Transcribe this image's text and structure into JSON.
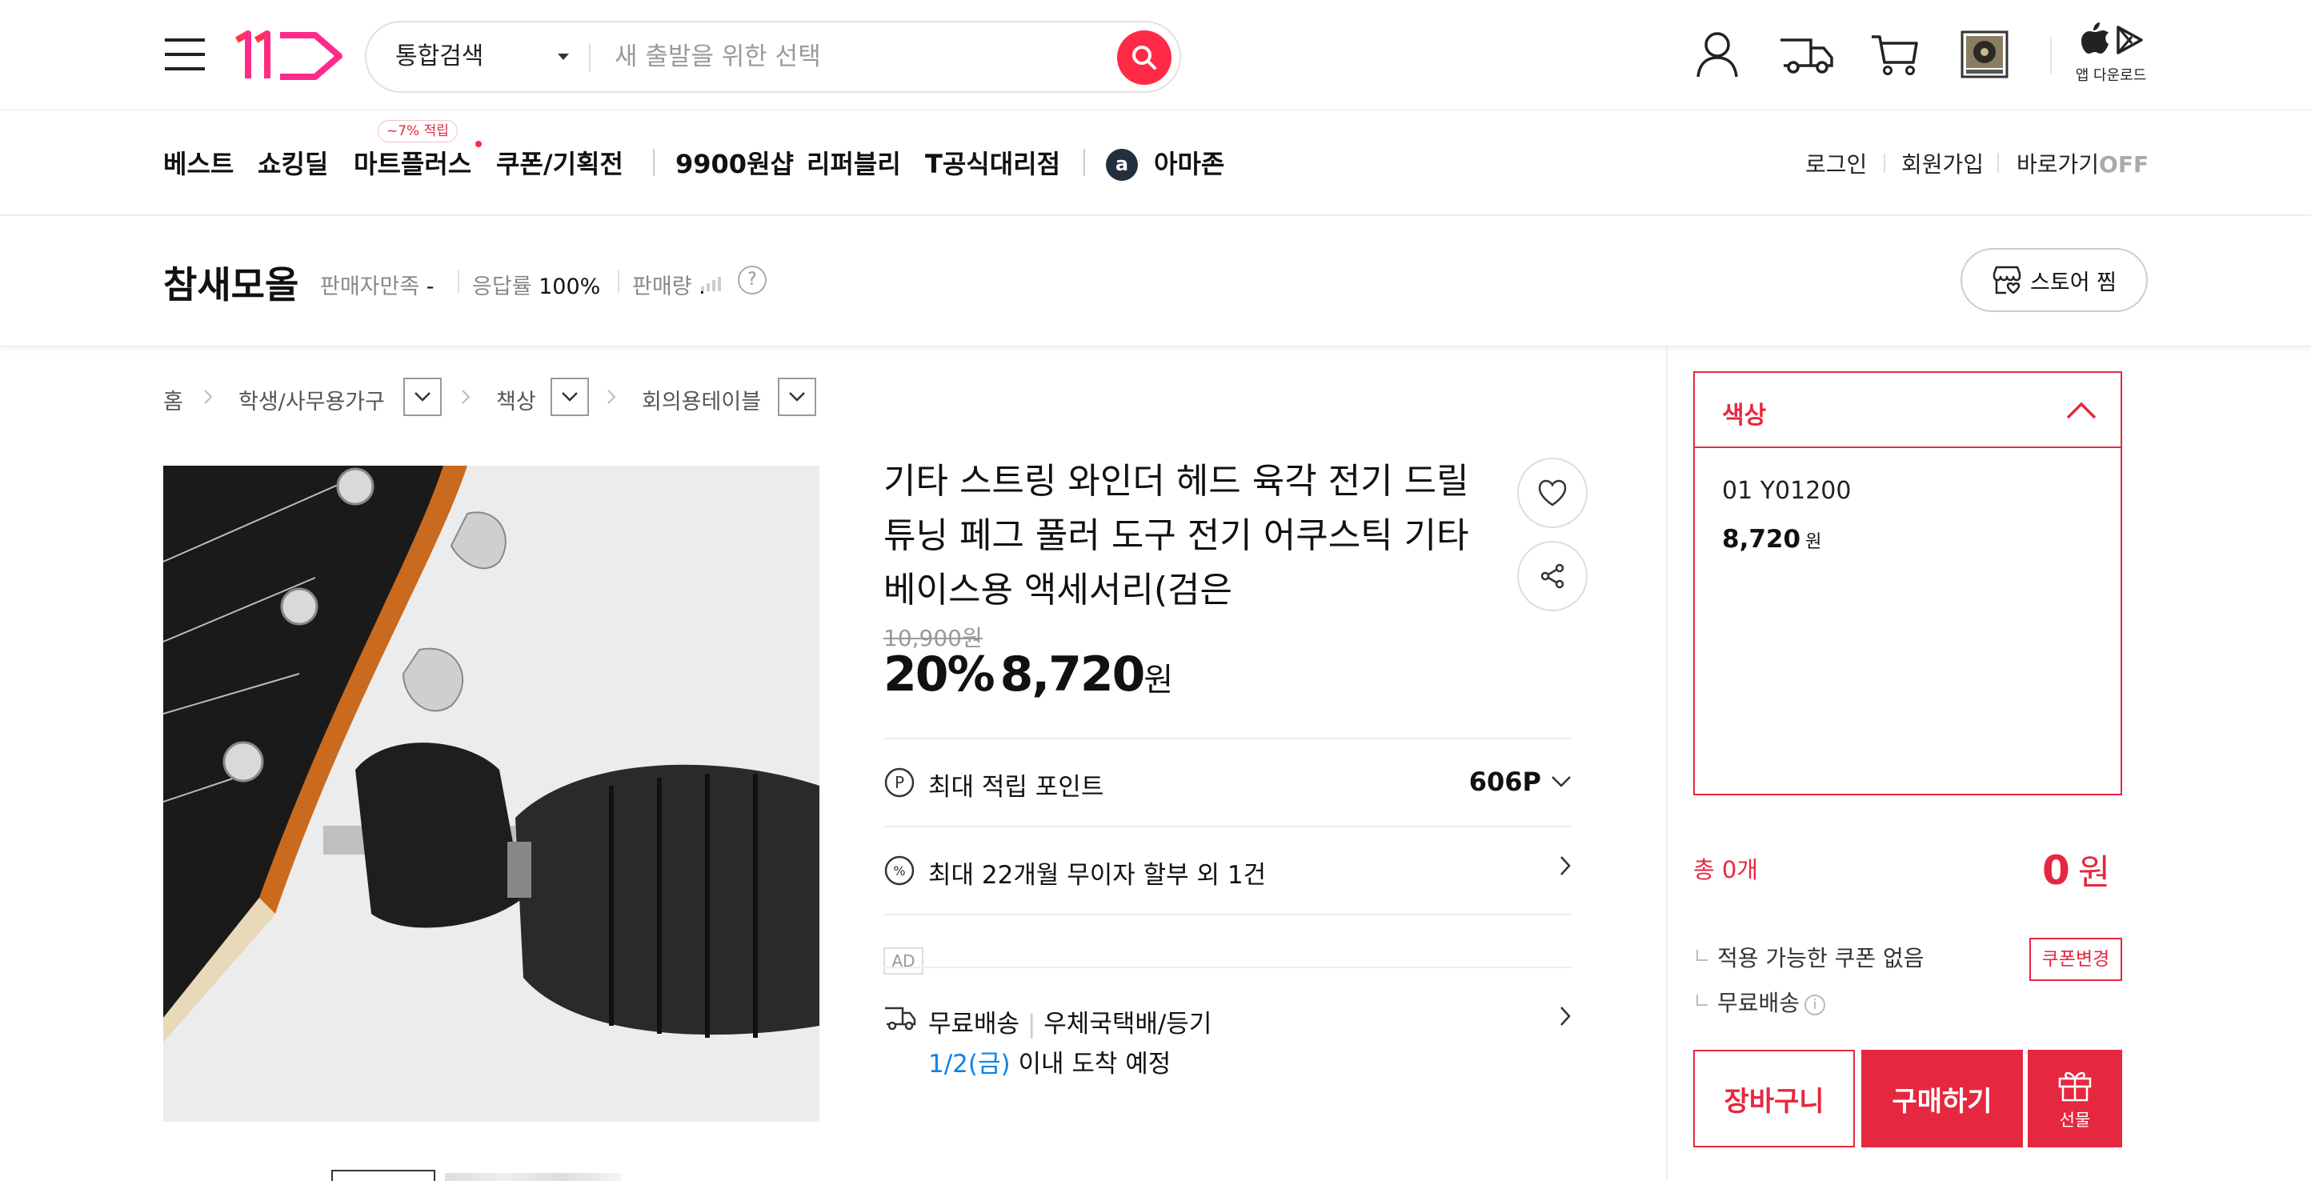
{
  "header": {
    "logo_text": "11",
    "search": {
      "category": "통합검색",
      "placeholder": "새 출발을 위한 선택"
    },
    "app_download_label": "앱 다운로드"
  },
  "nav": {
    "items": [
      "베스트",
      "쇼킹딜",
      "마트플러스",
      "쿠폰/기획전",
      "9900원샵",
      "리퍼블리",
      "T공식대리점",
      "아마존"
    ],
    "mart_badge": "~7% 적립",
    "amazon_logo_letter": "a",
    "right": {
      "login": "로그인",
      "signup": "회원가입",
      "shortcut": "바로가기",
      "shortcut_state": "OFF"
    }
  },
  "store": {
    "name": "참새모올",
    "satisfaction_label": "판매자만족",
    "satisfaction_value": "-",
    "response_label": "응답률",
    "response_value": "100%",
    "sales_label": "판매량",
    "sales_value": ".",
    "help": "?",
    "favorite_label": "스토어 찜"
  },
  "breadcrumb": [
    "홈",
    "학생/사무용가구",
    "책상",
    "회의용테이블"
  ],
  "product": {
    "title": "기타 스트링 와인더 헤드 육각 전기 드릴 튜닝 페그 풀러 도구 전기 어쿠스틱 기타 베이스용 액세서리(검은",
    "original_price": "10,900원",
    "discount": "20%",
    "price": "8,720",
    "price_unit": "원",
    "points_label": "최대 적립 포인트",
    "points_value": "606P",
    "installment_label": "최대 22개월 무이자 할부 외 1건",
    "ad_label": "AD",
    "shipping_free": "무료배송",
    "shipping_method": "우체국택배/등기",
    "arrival_date": "1/2(금)",
    "arrival_text": "이내 도착 예정"
  },
  "order_panel": {
    "option_label": "색상",
    "option_item": "01 Y01200",
    "option_price": "8,720",
    "option_price_unit": "원",
    "total_label": "총 0개",
    "total_amount": "0",
    "total_unit": "원",
    "coupon_text": "적용 가능한 쿠폰 없음",
    "coupon_button": "쿠폰변경",
    "free_shipping": "무료배송",
    "info_icon": "i",
    "cart_button": "장바구니",
    "buy_button": "구매하기",
    "gift_button": "선물"
  },
  "colors": {
    "accent": "#e5283f",
    "search_button": "#ff2a45",
    "link_blue": "#0b83e6"
  },
  "icons": [
    "hamburger-icon",
    "search-icon",
    "user-icon",
    "truck-icon",
    "cart-icon",
    "recent-item-icon",
    "apple-icon",
    "play-store-icon",
    "heart-icon",
    "share-icon",
    "point-icon",
    "percent-icon",
    "delivery-icon",
    "chevron-down-icon",
    "chevron-right-icon",
    "chevron-up-icon",
    "store-heart-icon",
    "gift-icon"
  ]
}
